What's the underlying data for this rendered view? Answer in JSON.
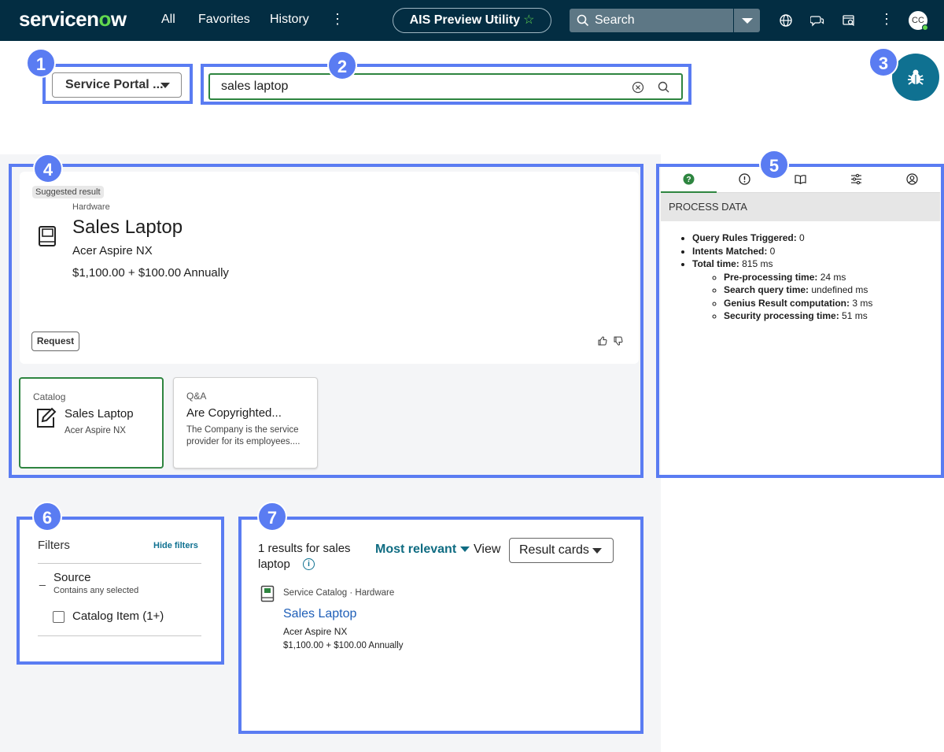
{
  "nav": {
    "logo_prefix": "servicen",
    "logo_o": "o",
    "logo_suffix": "w",
    "all": "All",
    "favorites": "Favorites",
    "history": "History",
    "more": "⋮",
    "app_pill": "AIS Preview Utility",
    "star": "☆",
    "search_label": "Search",
    "user_initials": "CC",
    "more_right": "⋮"
  },
  "badges": [
    "1",
    "2",
    "3",
    "4",
    "5",
    "6",
    "7"
  ],
  "header": {
    "source_select": "Service Portal ...",
    "query_value": "sales laptop"
  },
  "genius": {
    "tag": "Suggested result",
    "category": "Hardware",
    "title": "Sales Laptop",
    "subtitle": "Acer Aspire NX",
    "price": "$1,100.00 + $100.00 Annually",
    "request_label": "Request"
  },
  "cards": [
    {
      "category": "Catalog",
      "title": "Sales Laptop",
      "subtitle": "Acer Aspire NX"
    },
    {
      "category": "Q&A",
      "title": "Are Copyrighted...",
      "subtitle_line1": "The Company is the service",
      "subtitle_line2": "provider for its employees...."
    }
  ],
  "process": {
    "header": "PROCESS DATA",
    "items": [
      {
        "label": "Query Rules Triggered:",
        "value": " 0"
      },
      {
        "label": "Intents Matched:",
        "value": " 0"
      },
      {
        "label": "Total time:",
        "value": " 815 ms"
      }
    ],
    "subitems": [
      {
        "label": "Pre-processing time:",
        "value": " 24 ms"
      },
      {
        "label": "Search query time:",
        "value": " undefined ms"
      },
      {
        "label": "Genius Result computation:",
        "value": " 3 ms"
      },
      {
        "label": "Security processing time:",
        "value": " 51 ms"
      }
    ]
  },
  "filters": {
    "title": "Filters",
    "hide": "Hide filters",
    "minus": "_",
    "source": "Source",
    "source_sub": "Contains any selected",
    "option": "Catalog Item (1+)"
  },
  "results": {
    "count_line1": "1 results for sales",
    "count_line2": "laptop",
    "info": "i",
    "sort": "Most relevant",
    "view_label": "View",
    "view_value": "Result cards",
    "item": {
      "meta": "Service Catalog · Hardware",
      "title": "Sales Laptop",
      "subtitle": "Acer Aspire NX",
      "price": "$1,100.00 + $100.00 Annually"
    }
  },
  "colors": {
    "nav_bg": "#032d42",
    "accent_green": "#62d84e",
    "highlight_blue": "#5a7cf2",
    "teal": "#0f7191",
    "link_blue": "#1f5fb8"
  }
}
